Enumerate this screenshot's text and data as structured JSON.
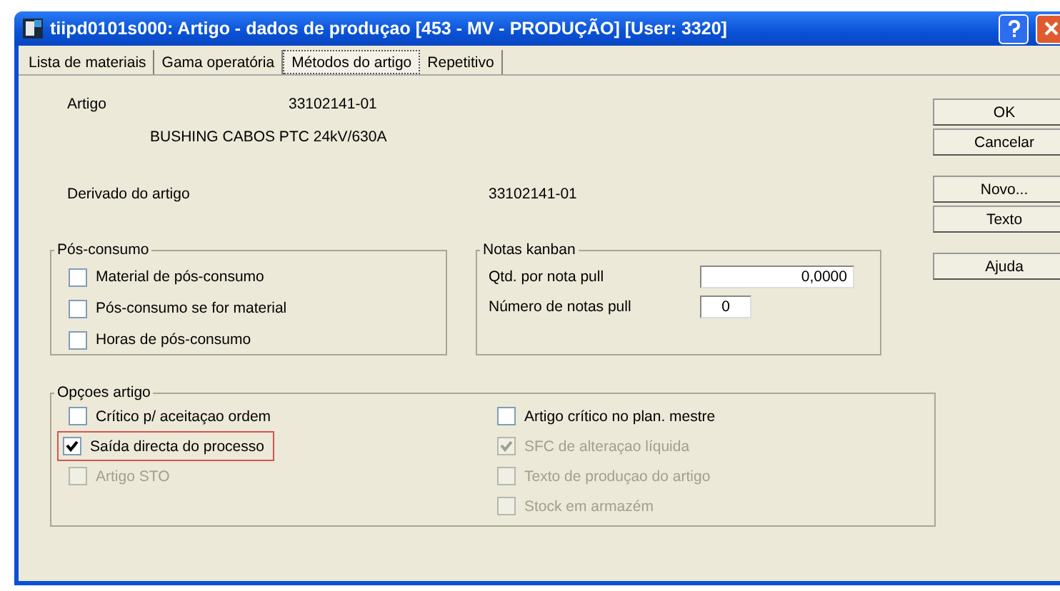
{
  "window": {
    "title": "tiipd0101s000: Artigo - dados de produçao [453 - MV  - PRODUÇÃO] [User: 3320]"
  },
  "tabs": [
    {
      "label": "Lista de materiais",
      "selected": false
    },
    {
      "label": "Gama operatória",
      "selected": false
    },
    {
      "label": "Métodos do artigo",
      "selected": true
    },
    {
      "label": "Repetitivo",
      "selected": false
    }
  ],
  "item": {
    "label": "Artigo",
    "value": "33102141-01",
    "description": "BUSHING CABOS PTC 24kV/630A"
  },
  "derived": {
    "label": "Derivado do artigo",
    "value": "33102141-01"
  },
  "post_consumption": {
    "title": "Pós-consumo",
    "options": [
      {
        "label": "Material de pós-consumo",
        "checked": false,
        "disabled": false
      },
      {
        "label": "Pós-consumo se for material",
        "checked": false,
        "disabled": false
      },
      {
        "label": "Horas de pós-consumo",
        "checked": false,
        "disabled": false
      }
    ]
  },
  "kanban": {
    "title": "Notas kanban",
    "fields": [
      {
        "label": "Qtd. por nota pull",
        "value": "0,0000",
        "kind": "wide"
      },
      {
        "label": "Número de notas pull",
        "value": "0",
        "kind": "narrow"
      }
    ]
  },
  "item_options": {
    "title": "Opçoes artigo",
    "columns": [
      [
        {
          "label": "Crítico p/ aceitaçao ordem",
          "checked": false,
          "disabled": false,
          "highlighted": false
        },
        {
          "label": "Saída directa do processo",
          "checked": true,
          "disabled": false,
          "highlighted": true
        },
        {
          "label": "Artigo STO",
          "checked": false,
          "disabled": true,
          "highlighted": false
        }
      ],
      [
        {
          "label": "Artigo crítico no plan. mestre",
          "checked": false,
          "disabled": false,
          "highlighted": false
        },
        {
          "label": "SFC de alteraçao líquida",
          "checked": true,
          "disabled": true,
          "highlighted": false
        },
        {
          "label": "Texto de produçao do artigo",
          "checked": false,
          "disabled": true,
          "highlighted": false
        },
        {
          "label": "Stock em armazém",
          "checked": false,
          "disabled": true,
          "highlighted": false
        }
      ]
    ]
  },
  "buttons": [
    {
      "label": "OK",
      "kind": "action"
    },
    {
      "label": "Cancelar",
      "kind": "action"
    },
    {
      "label": "Novo...",
      "kind": "gap"
    },
    {
      "label": "Texto",
      "kind": "action"
    },
    {
      "label": "Ajuda",
      "kind": "gap"
    }
  ]
}
